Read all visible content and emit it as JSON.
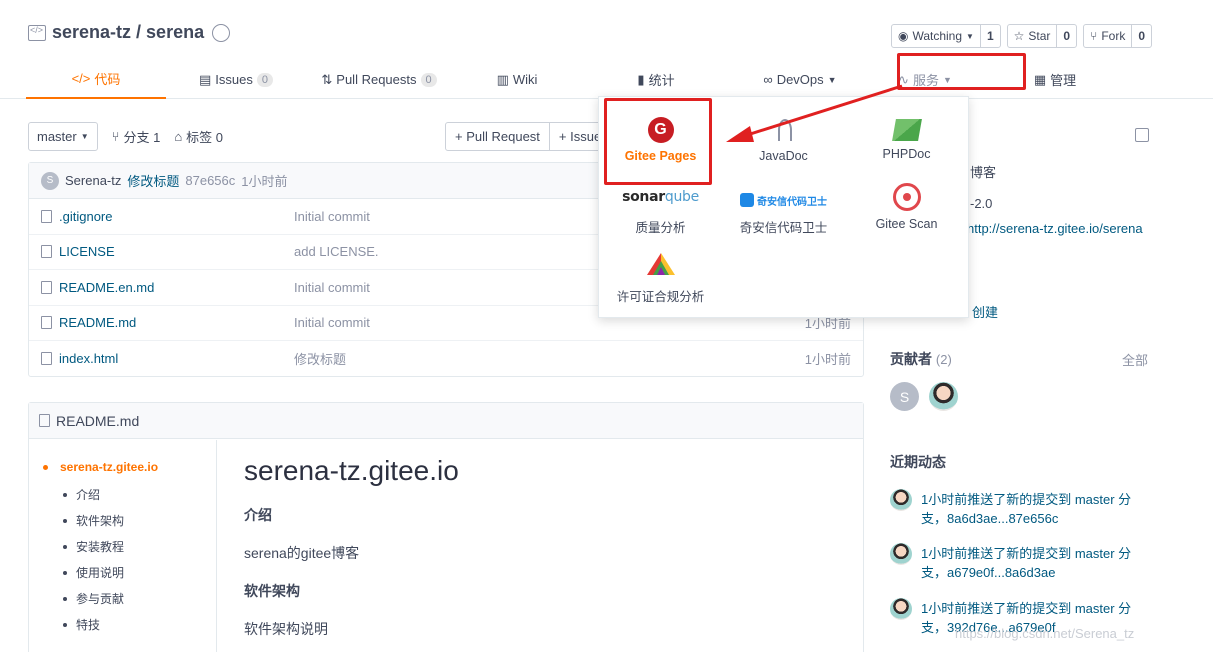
{
  "repo": {
    "owner": "serena-tz",
    "separator": " / ",
    "name": "serena"
  },
  "actions": {
    "watching_label": "Watching",
    "watching_count": "1",
    "star_label": "Star",
    "star_count": "0",
    "fork_label": "Fork",
    "fork_count": "0"
  },
  "tabs": [
    {
      "label": "代码",
      "count": ""
    },
    {
      "label": "Issues",
      "count": "0"
    },
    {
      "label": "Pull Requests",
      "count": "0"
    },
    {
      "label": "Wiki",
      "count": ""
    },
    {
      "label": "统计",
      "count": ""
    },
    {
      "label": "DevOps",
      "count": ""
    },
    {
      "label": "服务",
      "count": ""
    },
    {
      "label": "管理",
      "count": ""
    }
  ],
  "branch": {
    "current": "master",
    "branches_label": "分支 1",
    "tags_label": "标签 0",
    "pull_request_btn": "+ Pull Request",
    "issue_btn": "+ Issue"
  },
  "last_commit": {
    "avatar_letter": "S",
    "author": "Serena-tz",
    "message": "修改标题",
    "hash": "87e656c",
    "time": "1小时前"
  },
  "files": [
    {
      "name": ".gitignore",
      "message": "Initial commit",
      "time": ""
    },
    {
      "name": "LICENSE",
      "message": "add LICENSE.",
      "time": ""
    },
    {
      "name": "README.en.md",
      "message": "Initial commit",
      "time": ""
    },
    {
      "name": "README.md",
      "message": "Initial commit",
      "time": "1小时前"
    },
    {
      "name": "index.html",
      "message": "修改标题",
      "time": "1小时前"
    }
  ],
  "readme": {
    "file": "README.md",
    "toc_root": "serena-tz.gitee.io",
    "toc": [
      "介绍",
      "软件架构",
      "安装教程",
      "使用说明",
      "参与贡献",
      "特技"
    ],
    "h1": "serena-tz.gitee.io",
    "sec1": "介绍",
    "p1": "serena的gitee博客",
    "sec2": "软件架构",
    "p2": "软件架构说明"
  },
  "sidebar": {
    "desc": "博客",
    "license": "-2.0",
    "url": "http://serena-tz.gitee.io/serena",
    "created": "创建",
    "contributors_title": "贡献者",
    "contributors_count": "(2)",
    "all_label": "全部",
    "contributor_letter": "S",
    "activity_title": "近期动态",
    "activities": [
      {
        "line1": "1小时前推送了新的提交到 master 分",
        "line2": "支，8a6d3ae...87e656c"
      },
      {
        "line1": "1小时前推送了新的提交到 master 分",
        "line2": "支，a679e0f...8a6d3ae"
      },
      {
        "line1": "1小时前推送了新的提交到 master 分",
        "line2": "支，392d76e...a679e0f"
      }
    ]
  },
  "services": [
    {
      "label": "Gitee Pages",
      "icon": "gitee-pages-icon"
    },
    {
      "label": "JavaDoc",
      "icon": "javadoc-icon"
    },
    {
      "label": "PHPDoc",
      "icon": "phpdoc-icon"
    },
    {
      "label": "质量分析",
      "icon": "sonarqube-icon"
    },
    {
      "label": "奇安信代码卫士",
      "icon": "qianxin-icon"
    },
    {
      "label": "Gitee Scan",
      "icon": "gitee-scan-icon"
    },
    {
      "label": "许可证合规分析",
      "icon": "license-compliance-icon"
    }
  ],
  "sonar_logo": {
    "a": "sonar",
    "b": "qube"
  },
  "qax_logo": "奇安信代码卫士",
  "watermark": "https://blog.csdn.net/Serena_tz",
  "colors": {
    "accent": "#fe7300",
    "link": "#005980",
    "annotation": "#e02020"
  }
}
